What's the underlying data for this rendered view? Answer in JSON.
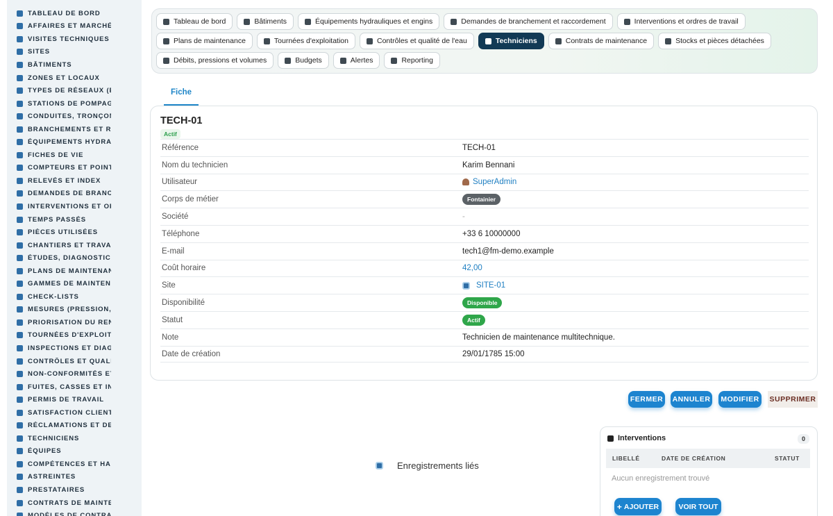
{
  "sidebar": {
    "items": [
      {
        "label": "TABLEAU DE BORD",
        "icon": "dashboard-icon"
      },
      {
        "label": "AFFAIRES ET MARCHÉS",
        "icon": "target-icon"
      },
      {
        "label": "VISITES TECHNIQUES ET",
        "icon": "checklist-icon"
      },
      {
        "label": "SITES",
        "icon": "map-pin-icon"
      },
      {
        "label": "BÂTIMENTS",
        "icon": "building-icon"
      },
      {
        "label": "ZONES ET LOCAUX",
        "icon": "rooms-icon"
      },
      {
        "label": "TYPES DE RÉSEAUX (EAU",
        "icon": "network-icon"
      },
      {
        "label": "STATIONS DE POMPAGE I",
        "icon": "grid-icon"
      },
      {
        "label": "CONDUITES, TRONÇONS",
        "icon": "pipe-icon"
      },
      {
        "label": "BRANCHEMENTS ET RAC",
        "icon": "branch-icon"
      },
      {
        "label": "ÉQUIPEMENTS HYDRAUL",
        "icon": "gears-icon"
      },
      {
        "label": "FICHES DE VIE",
        "icon": "history-icon"
      },
      {
        "label": "COMPTEURS ET POINTS I",
        "icon": "gauge-icon"
      },
      {
        "label": "RELEVÉS ET INDEX",
        "icon": "clipboard-icon"
      },
      {
        "label": "DEMANDES DE BRANCHE",
        "icon": "question-icon"
      },
      {
        "label": "INTERVENTIONS ET ORDI",
        "icon": "wrench-clipboard-icon"
      },
      {
        "label": "TEMPS PASSÉS",
        "icon": "clock-icon"
      },
      {
        "label": "PIÈCES UTILISÉES",
        "icon": "parts-icon"
      },
      {
        "label": "CHANTIERS ET TRAVAUX",
        "icon": "hammer-icon"
      },
      {
        "label": "ÉTUDES, DIAGNOSTICS E",
        "icon": "study-icon"
      },
      {
        "label": "PLANS DE MAINTENANCE",
        "icon": "calendar-icon"
      },
      {
        "label": "GAMMES DE MAINTENAN",
        "icon": "list-icon"
      },
      {
        "label": "CHECK-LISTS",
        "icon": "checklist-icon"
      },
      {
        "label": "MESURES (PRESSION, DÉ",
        "icon": "measure-icon"
      },
      {
        "label": "PRIORISATION DU RENOU",
        "icon": "priority-icon"
      },
      {
        "label": "TOURNÉES D'EXPLOITATI",
        "icon": "route-icon"
      },
      {
        "label": "INSPECTIONS ET DIAGNO",
        "icon": "search-icon"
      },
      {
        "label": "CONTRÔLES ET QUALITÉ",
        "icon": "quality-icon"
      },
      {
        "label": "NON-CONFORMITÉS ET A",
        "icon": "alert-circle-icon"
      },
      {
        "label": "FUITES, CASSES ET INCI",
        "icon": "warning-icon"
      },
      {
        "label": "PERMIS DE TRAVAIL",
        "icon": "permit-icon"
      },
      {
        "label": "SATISFACTION CLIENT",
        "icon": "smile-icon"
      },
      {
        "label": "RÉCLAMATIONS ET DEMA",
        "icon": "comment-icon"
      },
      {
        "label": "TECHNICIENS",
        "icon": "helmet-icon"
      },
      {
        "label": "ÉQUIPES",
        "icon": "team-icon"
      },
      {
        "label": "COMPÉTENCES ET HABIL",
        "icon": "skill-icon"
      },
      {
        "label": "ASTREINTES",
        "icon": "phone-icon"
      },
      {
        "label": "PRESTATAIRES",
        "icon": "handshake-icon"
      },
      {
        "label": "CONTRATS DE MAINTENA",
        "icon": "contract-icon"
      },
      {
        "label": "MODÈLES DE CONTRATS",
        "icon": "template-icon"
      }
    ]
  },
  "modules": [
    {
      "label": "Tableau de bord",
      "icon": "dashboard-icon",
      "active": false
    },
    {
      "label": "Bâtiments",
      "icon": "building-icon",
      "active": false
    },
    {
      "label": "Équipements hydrauliques et engins",
      "icon": "gears-icon",
      "active": false
    },
    {
      "label": "Demandes de branchement et raccordement",
      "icon": "question-icon",
      "active": false
    },
    {
      "label": "Interventions et ordres de travail",
      "icon": "wrench-clipboard-icon",
      "active": false
    },
    {
      "label": "Plans de maintenance",
      "icon": "calendar-icon",
      "active": false
    },
    {
      "label": "Tournées d'exploitation",
      "icon": "route-icon",
      "active": false
    },
    {
      "label": "Contrôles et qualité de l'eau",
      "icon": "quality-icon",
      "active": false
    },
    {
      "label": "Techniciens",
      "icon": "helmet-icon",
      "active": true
    },
    {
      "label": "Contrats de maintenance",
      "icon": "contract-icon",
      "active": false
    },
    {
      "label": "Stocks et pièces détachées",
      "icon": "stock-icon",
      "active": false
    },
    {
      "label": "Débits, pressions et volumes",
      "icon": "bolt-icon",
      "active": false
    },
    {
      "label": "Budgets",
      "icon": "money-icon",
      "active": false
    },
    {
      "label": "Alertes",
      "icon": "bell-icon",
      "active": false
    },
    {
      "label": "Reporting",
      "icon": "chart-pie-icon",
      "active": false
    }
  ],
  "tab": {
    "label": "Fiche"
  },
  "record": {
    "title": "TECH-01",
    "status_badge": "Actif",
    "fields": [
      {
        "label": "Référence",
        "value": "TECH-01",
        "kind": "text"
      },
      {
        "label": "Nom du technicien",
        "value": "Karim Bennani",
        "kind": "text"
      },
      {
        "label": "Utilisateur",
        "value": "SuperAdmin",
        "kind": "user-link"
      },
      {
        "label": "Corps de métier",
        "value": "Fontainier",
        "kind": "pill-grey"
      },
      {
        "label": "Société",
        "value": "-",
        "kind": "muted"
      },
      {
        "label": "Téléphone",
        "value": "+33 6 10000000",
        "kind": "text"
      },
      {
        "label": "E-mail",
        "value": "tech1@fm-demo.example",
        "kind": "text"
      },
      {
        "label": "Coût horaire",
        "value": "42,00",
        "kind": "link"
      },
      {
        "label": "Site",
        "value": "SITE-01",
        "kind": "site-link"
      },
      {
        "label": "Disponibilité",
        "value": "Disponible",
        "kind": "pill-green"
      },
      {
        "label": "Statut",
        "value": "Actif",
        "kind": "pill-green"
      },
      {
        "label": "Note",
        "value": "Technicien de maintenance multitechnique.",
        "kind": "text"
      },
      {
        "label": "Date de création",
        "value": "29/01/1785 15:00",
        "kind": "text"
      }
    ]
  },
  "actions": {
    "close": "FERMER",
    "cancel": "ANNULER",
    "edit": "MODIFIER",
    "delete": "SUPPRIMER"
  },
  "related": {
    "label": "Enregistrements liés",
    "panel": {
      "title": "Interventions",
      "count": "0",
      "columns": [
        "LIBELLÉ",
        "DATE DE CRÉATION",
        "STATUT"
      ],
      "empty": "Aucun enregistrement trouvé",
      "add": "AJOUTER",
      "view_all": "VOIR TOUT"
    }
  },
  "colors": {
    "primary": "#1d84cf",
    "active_module": "#123a55",
    "success": "#2fa64a",
    "sidebar_bg": "#eef3f6"
  }
}
